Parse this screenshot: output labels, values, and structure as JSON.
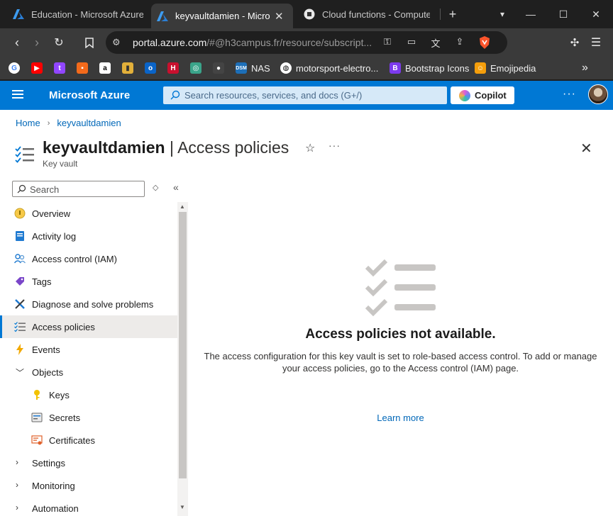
{
  "browser": {
    "tabs": [
      {
        "title": "Education - Microsoft Azure",
        "active": false
      },
      {
        "title": "keyvaultdamien - Microsoft",
        "active": true
      },
      {
        "title": "Cloud functions - Computer S",
        "active": false
      }
    ],
    "address": {
      "host": "portal.azure.com",
      "path": "/#@h3campus.fr/resource/subscript..."
    },
    "bookmarks": [
      "NAS",
      "motorsport-electro...",
      "Bootstrap Icons",
      "Emojipedia"
    ]
  },
  "azure": {
    "brand": "Microsoft Azure",
    "search_placeholder": "Search resources, services, and docs (G+/)",
    "copilot_label": "Copilot"
  },
  "breadcrumb": [
    "Home",
    "keyvaultdamien"
  ],
  "page": {
    "resource_name": "keyvaultdamien",
    "section": "| Access policies",
    "subtitle": "Key vault"
  },
  "left_search_placeholder": "Search",
  "nav": [
    {
      "label": "Overview"
    },
    {
      "label": "Activity log"
    },
    {
      "label": "Access control (IAM)"
    },
    {
      "label": "Tags"
    },
    {
      "label": "Diagnose and solve problems"
    },
    {
      "label": "Access policies",
      "active": true
    },
    {
      "label": "Events"
    },
    {
      "label": "Objects",
      "expanded": true
    },
    {
      "label": "Keys"
    },
    {
      "label": "Secrets"
    },
    {
      "label": "Certificates"
    },
    {
      "label": "Settings"
    },
    {
      "label": "Monitoring"
    },
    {
      "label": "Automation"
    }
  ],
  "empty_state": {
    "title": "Access policies not available.",
    "description": "The access configuration for this key vault is set to role-based access control. To add or manage your access policies, go to the Access control (IAM) page.",
    "link": "Learn more"
  },
  "colors": {
    "azure_blue": "#0078d4",
    "link": "#0067b8",
    "browser_dark": "#1f1f1f"
  }
}
